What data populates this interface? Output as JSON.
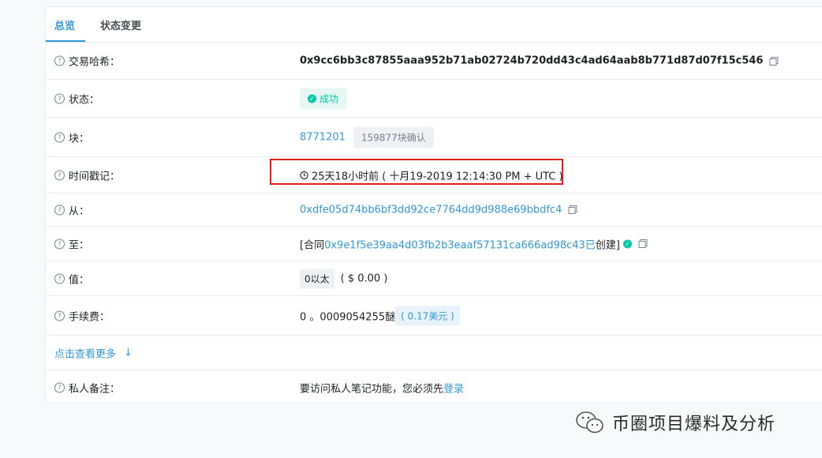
{
  "tabs": {
    "overview": "总览",
    "state": "状态变更"
  },
  "rows": {
    "tx_hash": {
      "label": "交易哈希：",
      "value": "0x9cc6bb3c87855aaa952b71ab02724b720dd43c4ad64aab8b771d87d07f15c546"
    },
    "status": {
      "label": "状态：",
      "value": "成功"
    },
    "block": {
      "label": "块：",
      "number": "8771201",
      "confirmations": "159877块确认"
    },
    "timestamp": {
      "label": "时间戳记：",
      "value": "25天18小时前 ( 十月19-2019 12:14:30 PM + UTC )"
    },
    "from": {
      "label": "从：",
      "value": "0xdfe05d74bb6bf3dd92ce7764dd9d988e69bbdfc4"
    },
    "to": {
      "label": "至：",
      "prefix": "[合同 ",
      "address": "0x9e1f5e39aa4d03fb2b3eaaf57131ca666ad98c43已",
      "suffix": " 创建]"
    },
    "value": {
      "label": "值：",
      "amount": "0以太",
      "fiat": "( $ 0.00 )"
    },
    "fee": {
      "label": "手续费：",
      "amount": "0 。0009054255醚",
      "fiat": "( 0.17美元 )"
    },
    "more": {
      "label": "点击查看更多"
    },
    "note": {
      "label": "私人备注：",
      "text": "要访问私人笔记功能，您必须先",
      "login": "登录"
    }
  },
  "watermark": {
    "text": "币圈项目爆料及分析"
  },
  "colors": {
    "accent": "#3498db",
    "success": "#00c9a7",
    "highlight": "#e02020"
  }
}
